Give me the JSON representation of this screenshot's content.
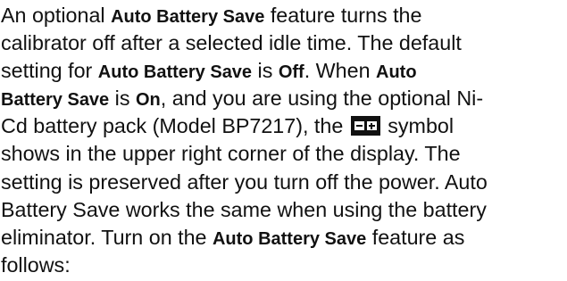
{
  "paragraph": {
    "l1": {
      "a": "An optional ",
      "b1": "Auto Battery Save",
      "c": " feature turns the"
    },
    "l2": {
      "a": "calibrator off after a selected idle time. The default"
    },
    "l3": {
      "a": "setting for ",
      "b1": "Auto Battery Save",
      "c": " is ",
      "b2": "Off",
      "d": ". When ",
      "b3": "Auto"
    },
    "l4": {
      "b1": "Battery Save",
      "a": " is ",
      "b2": "On",
      "c": ", and you are using the optional Ni-"
    },
    "l5": {
      "a": "Cd battery pack (Model BP7217), the ",
      "b": " symbol"
    },
    "l6": {
      "a": "shows in the upper right corner of the display. The"
    },
    "l7": {
      "a": "setting is preserved after you turn off the power. Auto"
    },
    "l8": {
      "a": "Battery Save works the same when using the battery"
    },
    "l9": {
      "a": "eliminator. Turn on the ",
      "b1": "Auto Battery Save",
      "c": " feature as"
    },
    "l10": {
      "a": "follows:"
    }
  },
  "icons": {
    "battery_symbol": "battery-icon"
  }
}
